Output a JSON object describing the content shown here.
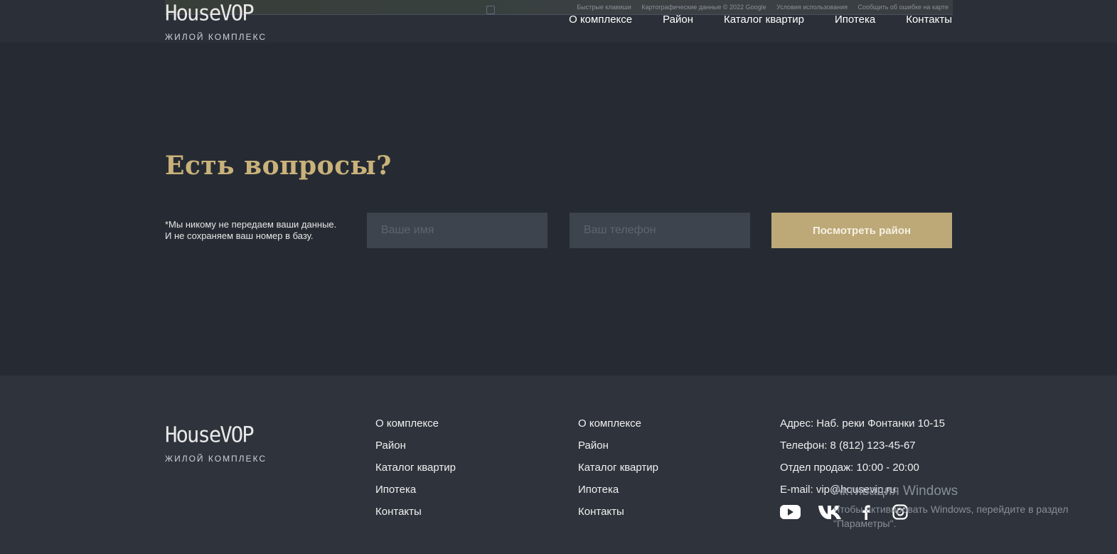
{
  "header": {
    "map_attribution": [
      "Быстрые клавиши",
      "Картографические данные © 2022 Google",
      "Условия использования",
      "Сообщить об ошибке на карте"
    ],
    "logo": {
      "name": "HouseVOP",
      "subtitle": "ЖИЛОЙ КОМПЛЕКС"
    },
    "nav": [
      "О комплексе",
      "Район",
      "Каталог квартир",
      "Ипотека",
      "Контакты"
    ]
  },
  "contact_section": {
    "title": "Есть вопросы?",
    "note_line1": "*Мы никому не передаем ваши данные.",
    "note_line2": "И не сохраняем ваш номер в базу.",
    "name_placeholder": "Ваше имя",
    "phone_placeholder": "Ваш телефон",
    "submit_label": "Посмотреть район"
  },
  "footer": {
    "logo": {
      "name": "HouseVOP",
      "subtitle": "ЖИЛОЙ КОМПЛЕКС"
    },
    "col1": [
      "О комплексе",
      "Район",
      "Каталог квартир",
      "Ипотека",
      "Контакты"
    ],
    "col2": [
      "О комплексе",
      "Район",
      "Каталог квартир",
      "Ипотека",
      "Контакты"
    ],
    "contacts": [
      "Адрес: Наб. реки Фонтанки 10-15",
      "Телефон: 8 (812) 123-45-67",
      "Отдел продаж: 10:00 - 20:00",
      "E-mail: vip@housevip.ru"
    ],
    "socials": [
      "youtube-icon",
      "vk-icon",
      "facebook-icon",
      "instagram-icon"
    ]
  },
  "watermark": {
    "title": "Активация Windows",
    "line1": "Чтобы активировать Windows, перейдите в раздел",
    "line2": "\"Параметры\"."
  },
  "colors": {
    "accent": "#c9b27a",
    "button": "#bda978",
    "bg": "#262b33",
    "footer_bg": "#2e333c",
    "input_bg": "#3e444d"
  }
}
